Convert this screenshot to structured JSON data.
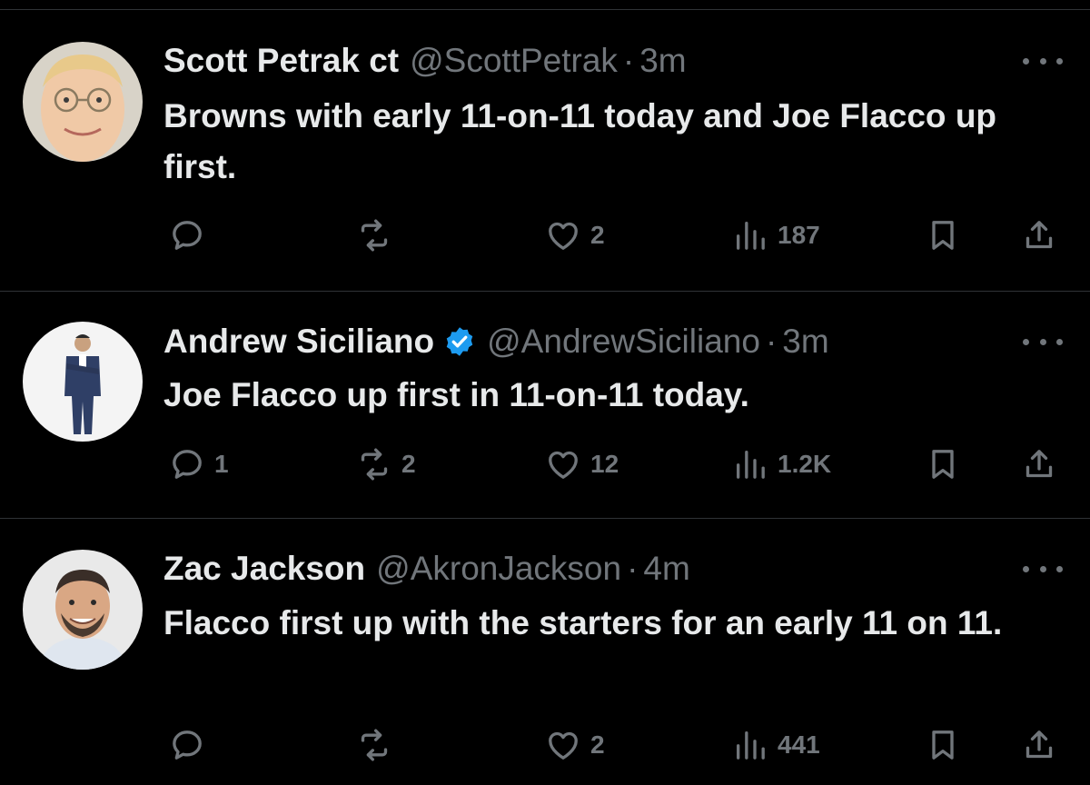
{
  "tweets": [
    {
      "display_name": "Scott Petrak ct",
      "verified": false,
      "handle": "@ScottPetrak",
      "separator": "·",
      "time": "3m",
      "text": "Browns with early 11-on-11 today and Joe Flacco up first.",
      "stats": {
        "replies": "",
        "reposts": "",
        "likes": "2",
        "views": "187"
      }
    },
    {
      "display_name": "Andrew Siciliano",
      "verified": true,
      "handle": "@AndrewSiciliano",
      "separator": "·",
      "time": "3m",
      "text": "Joe Flacco up first in 11-on-11 today.",
      "stats": {
        "replies": "1",
        "reposts": "2",
        "likes": "12",
        "views": "1.2K"
      }
    },
    {
      "display_name": "Zac Jackson",
      "verified": false,
      "handle": "@AkronJackson",
      "separator": "·",
      "time": "4m",
      "text": "Flacco first up with the starters for an early 11 on 11.",
      "stats": {
        "replies": "",
        "reposts": "",
        "likes": "2",
        "views": "441"
      }
    }
  ],
  "icons": {
    "reply": "reply-icon",
    "repost": "repost-icon",
    "like": "like-icon",
    "views": "views-icon",
    "bookmark": "bookmark-icon",
    "share": "share-icon",
    "more": "more-icon",
    "verified": "verified-badge-icon"
  },
  "colors": {
    "background": "#000000",
    "primary_text": "#e7e9ea",
    "secondary_text": "#71767b",
    "divider": "#2f3336",
    "verified_blue": "#1d9bf0"
  }
}
